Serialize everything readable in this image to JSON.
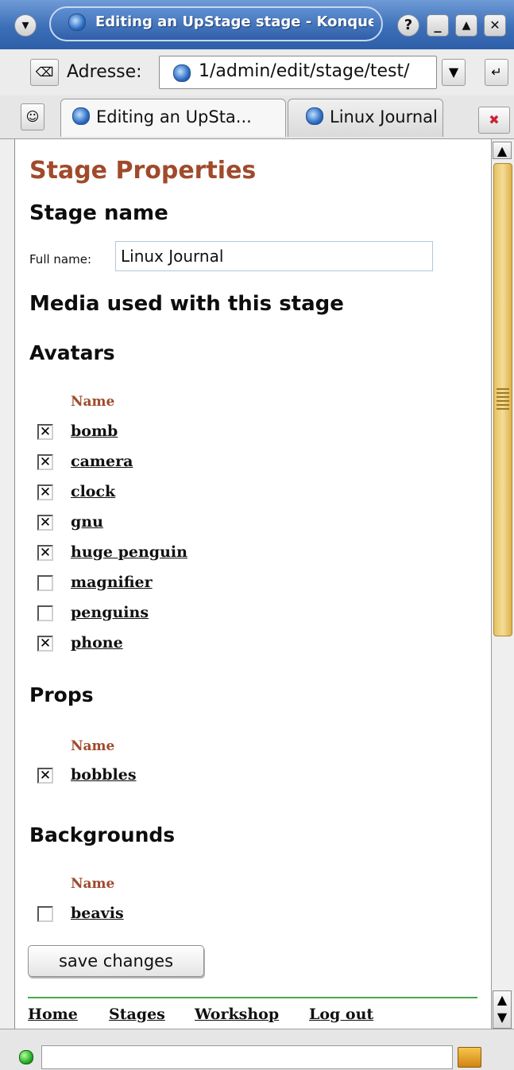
{
  "window": {
    "title": "Editing an UpStage stage - Konque",
    "buttons": {
      "help": "?",
      "minimize": "_",
      "maximize": "▲",
      "close": "✕"
    }
  },
  "location_bar": {
    "label": "Adresse:",
    "url": "1/admin/edit/stage/test/"
  },
  "tabs": [
    {
      "label": "Editing an UpSta...",
      "active": true
    },
    {
      "label": "Linux Journal",
      "active": false
    }
  ],
  "page": {
    "title": "Stage Properties",
    "stage_name_heading": "Stage name",
    "full_name_label": "Full name:",
    "full_name_value": "Linux Journal",
    "media_heading": "Media used with this stage",
    "avatars": {
      "heading": "Avatars",
      "column_header": "Name",
      "items": [
        {
          "name": "bomb",
          "checked": true
        },
        {
          "name": "camera",
          "checked": true
        },
        {
          "name": "clock",
          "checked": true
        },
        {
          "name": "gnu",
          "checked": true
        },
        {
          "name": "huge penguin",
          "checked": true
        },
        {
          "name": "magnifier",
          "checked": false
        },
        {
          "name": "penguins",
          "checked": false
        },
        {
          "name": "phone",
          "checked": true
        }
      ]
    },
    "props": {
      "heading": "Props",
      "column_header": "Name",
      "items": [
        {
          "name": "bobbles",
          "checked": true
        }
      ]
    },
    "backgrounds": {
      "heading": "Backgrounds",
      "column_header": "Name",
      "items": [
        {
          "name": "beavis",
          "checked": false
        }
      ]
    },
    "save_button": "save changes",
    "footer_links": [
      "Home",
      "Stages",
      "Workshop",
      "Log out"
    ]
  },
  "colors": {
    "heading_accent": "#a04a2c",
    "titlebar": "#3c6fb8",
    "scroll_thumb": "#e7c160",
    "footer_line": "#4aa84a"
  }
}
